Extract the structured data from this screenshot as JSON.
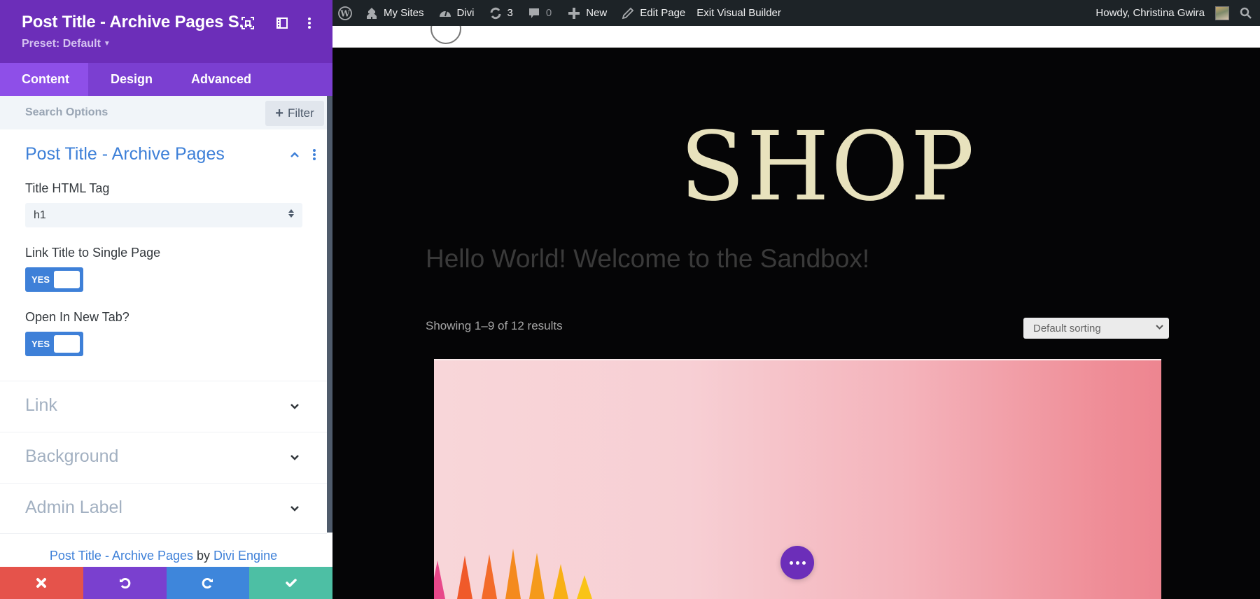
{
  "panel": {
    "title": "Post Title - Archive Pages S...",
    "preset": "Preset: Default",
    "icons": [
      "focus-icon",
      "layout-icon",
      "more-vertical-icon"
    ],
    "tabs": [
      {
        "label": "Content",
        "active": true
      },
      {
        "label": "Design",
        "active": false
      },
      {
        "label": "Advanced",
        "active": false
      }
    ],
    "search": {
      "placeholder": "Search Options",
      "value": ""
    },
    "filter_label": "Filter",
    "open_section": {
      "title": "Post Title - Archive Pages",
      "fields": {
        "title_html_tag": {
          "label": "Title HTML Tag",
          "value": "h1"
        },
        "link_title": {
          "label": "Link Title to Single Page",
          "value": "YES"
        },
        "open_new_tab": {
          "label": "Open In New Tab?",
          "value": "YES"
        }
      }
    },
    "collapsed_sections": [
      {
        "label": "Link"
      },
      {
        "label": "Background"
      },
      {
        "label": "Admin Label"
      }
    ],
    "credit": {
      "module_link": "Post Title - Archive Pages",
      "by": "by",
      "author_link": "Divi Engine"
    },
    "actions": {
      "discard": "close-icon",
      "undo": "undo-icon",
      "redo": "redo-icon",
      "save": "check-icon"
    },
    "colors": {
      "header": "#6c2eb9",
      "tabs": "#7b3fd1",
      "accent": "#3e80d8",
      "discard": "#e5534b",
      "undo": "#7a40cf",
      "redo": "#3e86db",
      "save": "#4dbfa4"
    }
  },
  "adminbar": {
    "items": [
      {
        "label": "My Sites",
        "icon": "my-sites-icon"
      },
      {
        "label": "Divi",
        "icon": "dashboard-icon"
      },
      {
        "label": "3",
        "icon": "updates-icon"
      },
      {
        "label": "0",
        "icon": "comments-icon"
      },
      {
        "label": "New",
        "icon": "plus-icon"
      },
      {
        "label": "Edit Page",
        "icon": "pencil-icon"
      },
      {
        "label": "Exit Visual Builder",
        "icon": ""
      }
    ],
    "greeting": "Howdy, Christina Gwira"
  },
  "page": {
    "shop_title": "SHOP",
    "hello": "Hello World! Welcome to the Sandbox!",
    "result_count": "Showing 1–9 of 12 results",
    "sorting": {
      "selected": "Default sorting"
    },
    "title_color": "#e8e2bd"
  }
}
